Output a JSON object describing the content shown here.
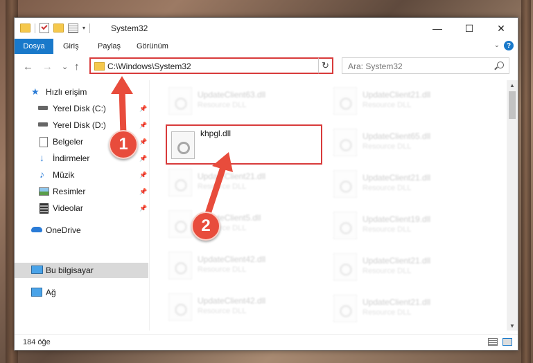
{
  "window": {
    "title": "System32",
    "minimize_glyph": "—",
    "maximize_glyph": "☐",
    "close_glyph": "✕"
  },
  "ribbon": {
    "tabs": [
      "Dosya",
      "Giriş",
      "Paylaş",
      "Görünüm"
    ],
    "help_glyph": "?",
    "expand_glyph": "⌄"
  },
  "nav": {
    "back_glyph": "←",
    "forward_glyph": "→",
    "recent_glyph": "⌄",
    "up_glyph": "↑",
    "address": "C:\\Windows\\System32",
    "refresh_glyph": "↻",
    "search_placeholder": "Ara: System32"
  },
  "sidebar": {
    "items": [
      {
        "label": "Hızlı erişim",
        "icon": "star-icon",
        "pinned": false
      },
      {
        "label": "Yerel Disk (C:)",
        "icon": "drive-icon",
        "pinned": true
      },
      {
        "label": "Yerel Disk (D:)",
        "icon": "drive-icon",
        "pinned": true
      },
      {
        "label": "Belgeler",
        "icon": "document-icon",
        "pinned": true
      },
      {
        "label": "İndirmeler",
        "icon": "download-icon",
        "pinned": true
      },
      {
        "label": "Müzik",
        "icon": "music-icon",
        "pinned": true
      },
      {
        "label": "Resimler",
        "icon": "pictures-icon",
        "pinned": true
      },
      {
        "label": "Videolar",
        "icon": "video-icon",
        "pinned": true
      },
      {
        "label": "OneDrive",
        "icon": "cloud-icon",
        "pinned": false
      },
      {
        "label": "Bu bilgisayar",
        "icon": "computer-icon",
        "pinned": false
      },
      {
        "label": "Ağ",
        "icon": "network-icon",
        "pinned": false
      }
    ],
    "selected": "Bu bilgisayar",
    "pin_glyph": "📌"
  },
  "files": {
    "left": [
      {
        "name": "UpdateClient63.dll",
        "type": "Resource DLL"
      },
      {
        "name": "khpgl.dll",
        "type": ""
      },
      {
        "name": "UpdateClient21.dll",
        "type": "Resource DLL"
      },
      {
        "name": "UpdateClient5.dll",
        "type": "Resource DLL"
      },
      {
        "name": "UpdateClient42.dll",
        "type": "Resource DLL"
      },
      {
        "name": "UpdateClient42.dll",
        "type": "Resource DLL"
      }
    ],
    "right": [
      {
        "name": "UpdateClient21.dll",
        "type": "Resource DLL"
      },
      {
        "name": "UpdateClient65.dll",
        "type": "Resource DLL"
      },
      {
        "name": "UpdateClient21.dll",
        "type": "Resource DLL"
      },
      {
        "name": "UpdateClient19.dll",
        "type": "Resource DLL"
      },
      {
        "name": "UpdateClient21.dll",
        "type": "Resource DLL"
      },
      {
        "name": "UpdateClient21.dll",
        "type": "Resource DLL"
      }
    ]
  },
  "status": {
    "count": "184 öğe"
  },
  "annotations": {
    "step1": "1",
    "step2": "2",
    "color": "#e84c3c"
  },
  "colors": {
    "accent": "#1979ca",
    "highlight": "#d83a3a"
  }
}
